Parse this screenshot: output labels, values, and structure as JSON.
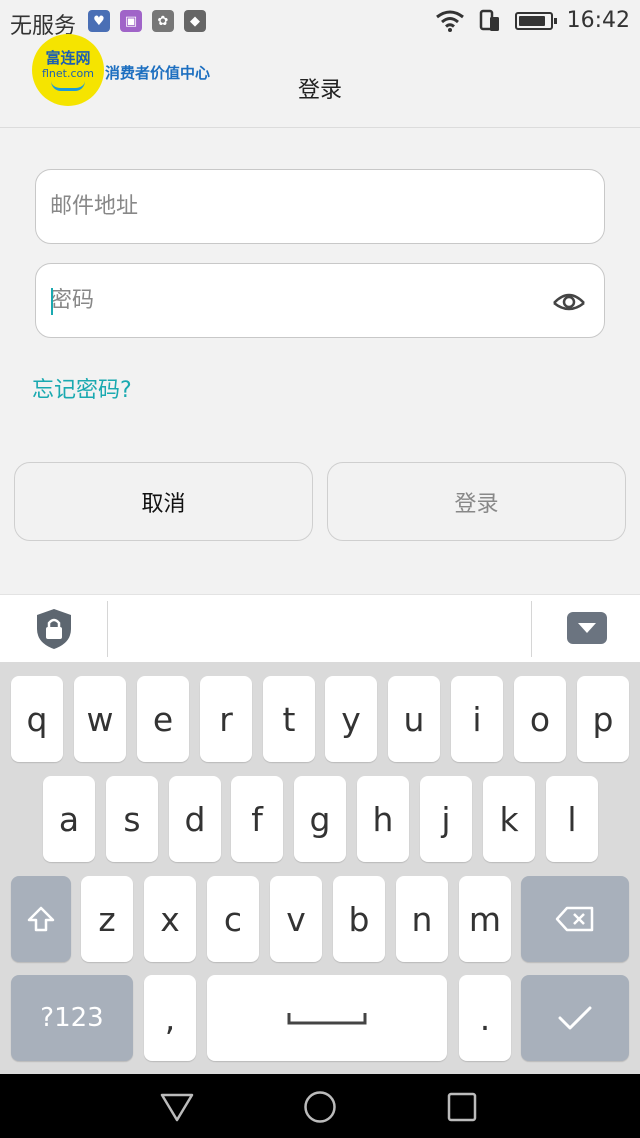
{
  "status_bar": {
    "carrier": "无服务",
    "time": "16:42",
    "battery_level": 0.85,
    "icons": [
      "health-icon",
      "gallery-icon",
      "huawei-icon",
      "vpn-icon",
      "wifi-icon",
      "sim-icon",
      "battery-icon"
    ]
  },
  "watermark": {
    "logo_cn": "富连网",
    "logo_en": "flnet.com",
    "tagline": "消费者价值中心"
  },
  "header": {
    "title": "登录"
  },
  "form": {
    "email_placeholder": "邮件地址",
    "password_placeholder": "密码",
    "forgot_password": "忘记密码?",
    "cancel_label": "取消",
    "login_label": "登录"
  },
  "keyboard": {
    "row1": [
      "q",
      "w",
      "e",
      "r",
      "t",
      "y",
      "u",
      "i",
      "o",
      "p"
    ],
    "row2": [
      "a",
      "s",
      "d",
      "f",
      "g",
      "h",
      "j",
      "k",
      "l"
    ],
    "row3": [
      "z",
      "x",
      "c",
      "v",
      "b",
      "n",
      "m"
    ],
    "symbols_label": "?123",
    "comma": ",",
    "period": "."
  },
  "colors": {
    "accent": "#1aa9b0",
    "key_function": "#a8b0bb",
    "keyboard_bg": "#dadada"
  }
}
